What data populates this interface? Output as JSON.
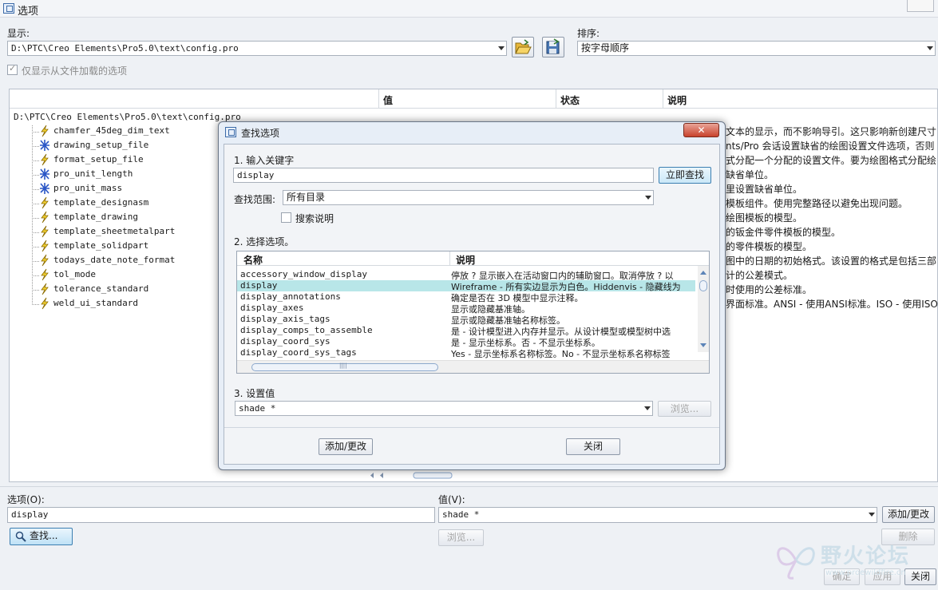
{
  "window": {
    "title": "选项"
  },
  "display": {
    "label": "显示:",
    "path": "D:\\PTC\\Creo Elements\\Pro5.0\\text\\config.pro"
  },
  "sort": {
    "label": "排序:",
    "value": "按字母顺序"
  },
  "only_loaded": {
    "label": "仅显示从文件加载的选项",
    "checked": true
  },
  "table": {
    "headers": {
      "value": "值",
      "status": "状态",
      "desc": "说明"
    },
    "root": "D:\\PTC\\Creo Elements\\Pro5.0\\text\\config.pro",
    "items": [
      {
        "name": "chamfer_45deg_dim_text",
        "icon": "lightning-icon"
      },
      {
        "name": "drawing_setup_file",
        "icon": "star-icon"
      },
      {
        "name": "format_setup_file",
        "icon": "lightning-icon"
      },
      {
        "name": "pro_unit_length",
        "icon": "star-icon"
      },
      {
        "name": "pro_unit_mass",
        "icon": "star-icon"
      },
      {
        "name": "template_designasm",
        "icon": "lightning-icon"
      },
      {
        "name": "template_drawing",
        "icon": "lightning-icon"
      },
      {
        "name": "template_sheetmetalpart",
        "icon": "lightning-icon"
      },
      {
        "name": "template_solidpart",
        "icon": "lightning-icon"
      },
      {
        "name": "todays_date_note_format",
        "icon": "lightning-icon"
      },
      {
        "name": "tol_mode",
        "icon": "lightning-icon"
      },
      {
        "name": "tolerance_standard",
        "icon": "lightning-icon"
      },
      {
        "name": "weld_ui_standard",
        "icon": "lightning-icon"
      }
    ],
    "desc_fragments": [
      "文本的显示，而不影响导引。这只影响新创建尺寸",
      "nts/Pro 会话设置缺省的绘图设置文件选项，否则",
      "式分配一个分配的设置文件。要为绘图格式分配绘",
      "缺省单位。",
      "里设置缺省单位。",
      "模板组件。使用完整路径以避免出现问题。",
      "绘图模板的模型。",
      "的钣金件零件模板的模型。",
      "的零件模板的模型。",
      "图中的日期的初始格式。该设置的格式是包括三部",
      "计的公差模式。",
      "时使用的公差标准。",
      "界面标准。ANSI - 使用ANSI标准。ISO - 使用ISO"
    ]
  },
  "bottom": {
    "option_label": "选项(O):",
    "option_value": "display",
    "value_label": "值(V):",
    "value_value": "shade *",
    "add_change": "添加/更改",
    "find": "查找...",
    "browse": "浏览...",
    "delete": "删除",
    "ok": "确定",
    "apply": "应用",
    "close": "关闭"
  },
  "watermark": {
    "text": "野火论坛",
    "url": "www.proewildfire.cn"
  },
  "dialog": {
    "title": "查找选项",
    "step1": "1.  输入关键字",
    "keyword": "display",
    "find_now": "立即查找",
    "scope_label": "查找范围:",
    "scope_value": "所有目录",
    "search_desc": "搜索说明",
    "search_desc_checked": false,
    "step2": "2.  选择选项。",
    "list_headers": {
      "name": "名称",
      "desc": "说明"
    },
    "rows": [
      {
        "name": "accessory_window_display",
        "desc": "停放 ? 显示嵌入在活动窗口内的辅助窗口。取消停放 ? 以",
        "selected": false
      },
      {
        "name": "display",
        "desc": "Wireframe - 所有实边显示为白色。Hiddenvis - 隐藏线为",
        "selected": true
      },
      {
        "name": "display_annotations",
        "desc": "确定是否在 3D 模型中显示注释。",
        "selected": false
      },
      {
        "name": "display_axes",
        "desc": "显示或隐藏基准轴。",
        "selected": false
      },
      {
        "name": "display_axis_tags",
        "desc": "显示或隐藏基准轴名称标签。",
        "selected": false
      },
      {
        "name": "display_comps_to_assemble",
        "desc": "是 - 设计模型进入内存并显示。从设计模型或模型树中选",
        "selected": false
      },
      {
        "name": "display_coord_sys",
        "desc": "是 - 显示坐标系。否 - 不显示坐标系。",
        "selected": false
      },
      {
        "name": "display_coord_sys_tags",
        "desc": "Yes - 显示坐标系名称标签。No - 不显示坐标系名称标签",
        "selected": false
      }
    ],
    "step3": "3.  设置值",
    "set_value": "shade *",
    "browse": "浏览...",
    "add_change": "添加/更改",
    "close": "关闭"
  }
}
